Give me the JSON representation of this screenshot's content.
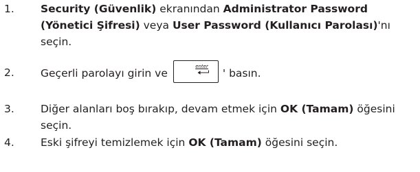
{
  "steps": [
    {
      "number": "1.",
      "parts": [
        {
          "text": "Security (Güvenlik)",
          "bold": true
        },
        {
          "text": " ekranından ",
          "bold": false
        },
        {
          "text": "Administrator Password (Yönetici Şifresi)",
          "bold": true
        },
        {
          "text": " veya ",
          "bold": false
        },
        {
          "text": "User Password (Kullanıcı Parolası)",
          "bold": true
        },
        {
          "text": "'nı seçin.",
          "bold": false
        }
      ]
    },
    {
      "number": "2.",
      "before_key": "Geçerli parolayı girin ve",
      "key_label": "enter",
      "after_key": "' basın."
    },
    {
      "number": "3.",
      "parts": [
        {
          "text": "Diğer alanları boş bırakıp, devam etmek için ",
          "bold": false
        },
        {
          "text": "OK (Tamam)",
          "bold": true
        },
        {
          "text": " öğesini seçin.",
          "bold": false
        }
      ]
    },
    {
      "number": "4.",
      "parts": [
        {
          "text": "Eski şifreyi temizlemek için ",
          "bold": false
        },
        {
          "text": "OK (Tamam)",
          "bold": true
        },
        {
          "text": " öğesini seçin.",
          "bold": false
        }
      ]
    }
  ],
  "key_icon": "enter-key-icon"
}
